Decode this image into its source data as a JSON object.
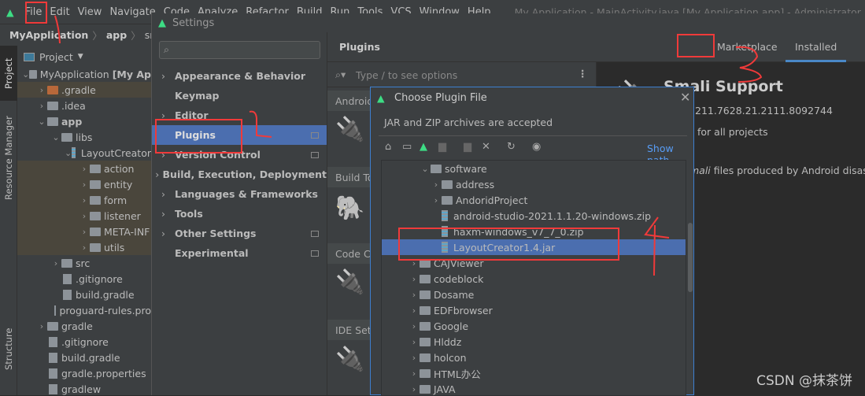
{
  "menubar": {
    "items": [
      "File",
      "Edit",
      "View",
      "Navigate",
      "Code",
      "Analyze",
      "Refactor",
      "Build",
      "Run",
      "Tools",
      "VCS",
      "Window",
      "Help"
    ],
    "window_title": "My Application - MainActivity.java [My Application.app] - Administrator"
  },
  "breadcrumb": [
    "MyApplication",
    "app",
    "src"
  ],
  "toolstrip": {
    "project": "Project",
    "resource_manager": "Resource Manager",
    "structure": "Structure"
  },
  "project_panel": {
    "header": "Project",
    "rows": [
      {
        "label": "MyApplication",
        "suffix": "[My Ap",
        "level": 0,
        "chev": "down"
      },
      {
        "label": ".gradle",
        "level": 1,
        "chev": "right"
      },
      {
        "label": ".idea",
        "level": 1,
        "chev": "right"
      },
      {
        "label": "app",
        "level": 1,
        "chev": "down"
      },
      {
        "label": "libs",
        "level": 2,
        "chev": "down"
      },
      {
        "label": "LayoutCreator",
        "level": 3,
        "chev": "down"
      },
      {
        "label": "action",
        "level": 4,
        "chev": "right"
      },
      {
        "label": "entity",
        "level": 4,
        "chev": "right"
      },
      {
        "label": "form",
        "level": 4,
        "chev": "right"
      },
      {
        "label": "listener",
        "level": 4,
        "chev": "right"
      },
      {
        "label": "META-INF",
        "level": 4,
        "chev": "right"
      },
      {
        "label": "utils",
        "level": 4,
        "chev": "right"
      },
      {
        "label": "src",
        "level": 2,
        "chev": "right"
      },
      {
        "label": ".gitignore",
        "level": 2,
        "chev": ""
      },
      {
        "label": "build.gradle",
        "level": 2,
        "chev": ""
      },
      {
        "label": "proguard-rules.pro",
        "level": 2,
        "chev": ""
      },
      {
        "label": "gradle",
        "level": 1,
        "chev": "right"
      },
      {
        "label": ".gitignore",
        "level": 1,
        "chev": ""
      },
      {
        "label": "build.gradle",
        "level": 1,
        "chev": ""
      },
      {
        "label": "gradle.properties",
        "level": 1,
        "chev": ""
      },
      {
        "label": "gradlew",
        "level": 1,
        "chev": ""
      }
    ]
  },
  "settings": {
    "title": "Settings",
    "sidebar": [
      {
        "label": "Appearance & Behavior",
        "chev": true,
        "badge": false
      },
      {
        "label": "Keymap",
        "chev": false,
        "badge": false
      },
      {
        "label": "Editor",
        "chev": true,
        "badge": false
      },
      {
        "label": "Plugins",
        "chev": false,
        "badge": true,
        "selected": true
      },
      {
        "label": "Version Control",
        "chev": true,
        "badge": true
      },
      {
        "label": "Build, Execution, Deployment",
        "chev": true,
        "badge": false
      },
      {
        "label": "Languages & Frameworks",
        "chev": true,
        "badge": false
      },
      {
        "label": "Tools",
        "chev": true,
        "badge": false
      },
      {
        "label": "Other Settings",
        "chev": true,
        "badge": true
      },
      {
        "label": "Experimental",
        "chev": false,
        "badge": true
      }
    ]
  },
  "plugins": {
    "title": "Plugins",
    "tabs": [
      "Marketplace",
      "Installed"
    ],
    "active_tab": "Installed",
    "search_placeholder": "Type / to see options",
    "groups": [
      "Android",
      "Build Tools",
      "Code Coverage",
      "IDE Settings"
    ],
    "detail": {
      "name": "Smali Support",
      "version": "211.7628.21.2111.8092744",
      "scope": "for all projects",
      "desc_italic": "mali",
      "desc": " files produced by Android disas"
    }
  },
  "dialog": {
    "title": "Choose Plugin File",
    "hint": "JAR and ZIP archives are accepted",
    "show_path": "Show path",
    "tree": [
      {
        "label": "software",
        "level": 2,
        "chev": "down",
        "type": "folder"
      },
      {
        "label": "address",
        "level": 3,
        "chev": "right",
        "type": "folder"
      },
      {
        "label": "AndoridProject",
        "level": 3,
        "chev": "right",
        "type": "folder"
      },
      {
        "label": "android-studio-2021.1.1.20-windows.zip",
        "level": 3,
        "chev": "",
        "type": "zip"
      },
      {
        "label": "haxm-windows_v7_7_0.zip",
        "level": 3,
        "chev": "",
        "type": "zip"
      },
      {
        "label": "LayoutCreator1.4.jar",
        "level": 3,
        "chev": "",
        "type": "zip",
        "selected": true
      },
      {
        "label": "CAJViewer",
        "level": 1,
        "chev": "right",
        "type": "folder"
      },
      {
        "label": "codeblock",
        "level": 1,
        "chev": "right",
        "type": "folder"
      },
      {
        "label": "Dosame",
        "level": 1,
        "chev": "right",
        "type": "folder"
      },
      {
        "label": "EDFbrowser",
        "level": 1,
        "chev": "right",
        "type": "folder"
      },
      {
        "label": "Google",
        "level": 1,
        "chev": "right",
        "type": "folder"
      },
      {
        "label": "Hlddz",
        "level": 1,
        "chev": "right",
        "type": "folder"
      },
      {
        "label": "holcon",
        "level": 1,
        "chev": "right",
        "type": "folder"
      },
      {
        "label": "HTML办公",
        "level": 1,
        "chev": "right",
        "type": "folder"
      },
      {
        "label": "JAVA",
        "level": 1,
        "chev": "right",
        "type": "folder"
      }
    ]
  },
  "watermark": "CSDN @抹茶饼",
  "colors": {
    "accent": "#4b6eaf",
    "annotation": "#f03a3a",
    "link": "#589df6",
    "android": "#3ddc84"
  }
}
